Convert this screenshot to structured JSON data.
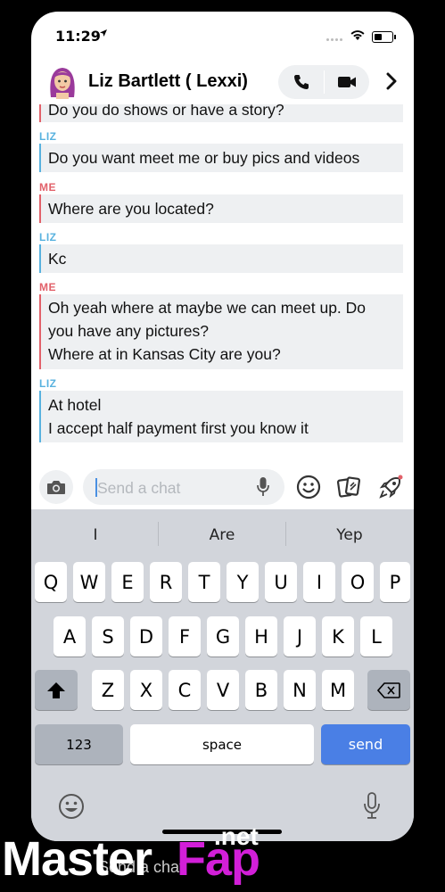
{
  "status": {
    "time": "11:29",
    "location_icon": "location-arrow-icon",
    "wifi_icon": "wifi-icon",
    "battery_icon": "battery-icon"
  },
  "header": {
    "contact_name": "Liz Bartlett ( Lexxi)",
    "avatar_icon": "bitmoji-avatar",
    "call_icon": "phone-icon",
    "video_icon": "video-camera-icon",
    "more_icon": "chevron-right-icon"
  },
  "messages": [
    {
      "sender": "",
      "side": "me",
      "lines": [
        "Do you do shows or have a story?"
      ]
    },
    {
      "sender": "LIZ",
      "side": "liz",
      "lines": [
        "Do you want meet me or buy pics and videos"
      ]
    },
    {
      "sender": "ME",
      "side": "me",
      "lines": [
        "Where are you located?"
      ]
    },
    {
      "sender": "LIZ",
      "side": "liz",
      "lines": [
        "Kc"
      ]
    },
    {
      "sender": "ME",
      "side": "me",
      "lines": [
        "Oh yeah where at maybe we can meet up.  Do",
        "you have any pictures?",
        "Where at in Kansas City are you?"
      ]
    },
    {
      "sender": "LIZ",
      "side": "liz",
      "lines": [
        "At hotel",
        "I accept half payment  first  you know it"
      ]
    }
  ],
  "chatbar": {
    "placeholder": "Send a chat",
    "camera_icon": "camera-icon",
    "mic_icon": "microphone-icon",
    "emoji_icon": "smiley-icon",
    "cards_icon": "cards-icon",
    "games_icon": "rocket-icon"
  },
  "keyboard": {
    "suggestions": [
      "I",
      "Are",
      "Yep"
    ],
    "row1": [
      "Q",
      "W",
      "E",
      "R",
      "T",
      "Y",
      "U",
      "I",
      "O",
      "P"
    ],
    "row2": [
      "A",
      "S",
      "D",
      "F",
      "G",
      "H",
      "J",
      "K",
      "L"
    ],
    "row3": [
      "Z",
      "X",
      "C",
      "V",
      "B",
      "N",
      "M"
    ],
    "numbers_label": "123",
    "space_label": "space",
    "send_label": "send",
    "shift_icon": "shift-icon",
    "delete_icon": "backspace-icon",
    "emoji_icon": "emoji-icon",
    "dictation_icon": "microphone-icon"
  },
  "watermark": {
    "part1": "Master",
    "part2": "Fap",
    "suffix": ".net",
    "behind_text": "Send a chat"
  },
  "colors": {
    "me": "#e2616a",
    "liz": "#58b2df",
    "send_key": "#4a7fe5",
    "brand_fap": "#d21fd8"
  }
}
